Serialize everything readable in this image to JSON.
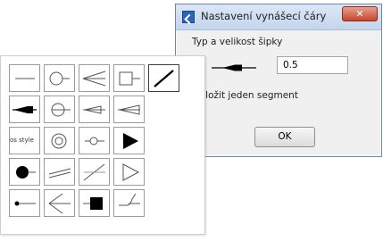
{
  "dialog": {
    "title": "Nastavení vynášecí čáry",
    "close_glyph": "✕",
    "arrow_type_label": "Typ a velikost šipky",
    "arrow_size_value": "0.5",
    "segment_label": "Vložit jeden segment",
    "ok_label": "OK"
  },
  "palette": {
    "style_cell_label": "os style"
  },
  "icons": {
    "app": "line-dialog-app-icon",
    "close": "close-icon"
  }
}
